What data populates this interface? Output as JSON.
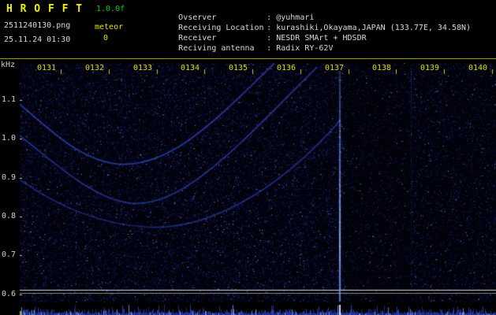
{
  "header": {
    "app_title": "H R O F F T",
    "version": "1.0.0f",
    "filename": "2511240130.png",
    "meteor_label": "meteor",
    "meteor_count": "0",
    "datetime": "25.11.24 01:30",
    "info": [
      {
        "label": "Ovserver",
        "value": "@yuhmari"
      },
      {
        "label": "Receiving Location",
        "value": "kurashiki,Okayama,JAPAN (133.77E, 34.58N)"
      },
      {
        "label": "Receiver",
        "value": "NESDR SMArt + HDSDR"
      },
      {
        "label": "Reciving antenna",
        "value": "Radix RY-62V"
      }
    ]
  },
  "chart_data": {
    "type": "heatmap",
    "ylabel": "kHz",
    "x_ticks": [
      "0131",
      "0132",
      "0133",
      "0134",
      "0135",
      "0136",
      "0137",
      "0138",
      "0139",
      "0140"
    ],
    "y_ticks": [
      "1.1",
      "1.0",
      "0.9",
      "0.8",
      "0.7",
      "0.6"
    ],
    "y_range_khz": [
      0.58,
      1.2
    ],
    "features": {
      "background": "dark blue noise speckle on black",
      "aircraft_doppler_curves": 3,
      "vertical_echo_at": "0137",
      "carrier_lines_khz": [
        0.62,
        0.61
      ],
      "quieter_band_after": "0137",
      "meteor_count": 0
    },
    "bottom_strip": "broadband signal-level trace with spike at 0137"
  },
  "colors": {
    "accent_yellow": "#e0e000",
    "text_white": "#d8d8d8",
    "version_green": "#00d000",
    "noise_blue": "#3550dd",
    "background": "#000000"
  }
}
